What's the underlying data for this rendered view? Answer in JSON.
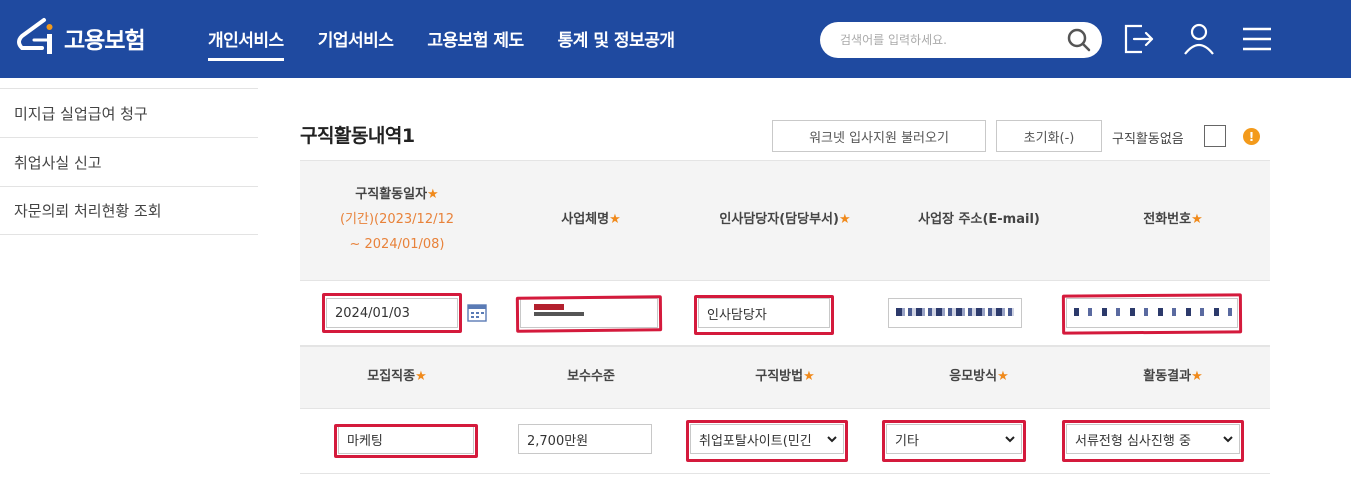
{
  "header": {
    "logo_text": "고용보험",
    "nav": [
      "개인서비스",
      "기업서비스",
      "고용보험 제도",
      "통계 및 정보공개"
    ],
    "search_placeholder": "검색어를 입력하세요."
  },
  "sidebar": {
    "items": [
      "미지급 실업급여 청구",
      "취업사실 신고",
      "자문의뢰 처리현황 조회"
    ]
  },
  "section": {
    "title": "구직활동내역1",
    "btn_worknet": "워크넷 입사지원 불러오기",
    "btn_reset": "초기화(-)",
    "no_activity_label": "구직활동없음",
    "info_glyph": "!"
  },
  "table": {
    "row1_headers": {
      "date": "구직활동일자",
      "period_line1": "(기간)(2023/12/12",
      "period_line2": "~ 2024/01/08)",
      "company": "사업체명",
      "hr_contact": "인사담당자(담당부서)",
      "address": "사업장 주소(E-mail)",
      "phone": "전화번호"
    },
    "required_mark": "★",
    "row1_values": {
      "date": "2024/01/03",
      "company": "",
      "hr_contact": "인사담당자",
      "address": "",
      "phone": ""
    },
    "row2_headers": {
      "job_type": "모집직종",
      "salary": "보수수준",
      "method": "구직방법",
      "apply_type": "응모방식",
      "result": "활동결과"
    },
    "row2_values": {
      "job_type": "마케팅",
      "salary": "2,700만원",
      "method": "취업포탈사이트(민긴",
      "apply_type": "기타",
      "result": "서류전형 심사진행 중"
    }
  },
  "colors": {
    "header_bg": "#1f4aa0",
    "highlight": "#d41a3c",
    "required": "#f08a1c"
  }
}
